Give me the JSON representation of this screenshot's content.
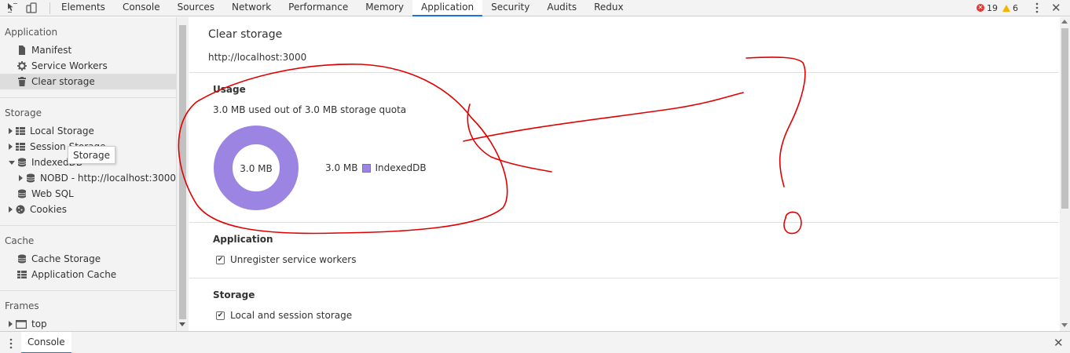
{
  "toolbar": {
    "tabs": [
      "Elements",
      "Console",
      "Sources",
      "Network",
      "Performance",
      "Memory",
      "Application",
      "Security",
      "Audits",
      "Redux"
    ],
    "active_tab": "Application",
    "error_count": "19",
    "warning_count": "6"
  },
  "sidebar": {
    "application_title": "Application",
    "application_items": [
      "Manifest",
      "Service Workers",
      "Clear storage"
    ],
    "storage_title": "Storage",
    "storage_items": [
      "Local Storage",
      "Session Storage",
      "IndexedDB",
      "NOBD - http://localhost:3000",
      "Web SQL",
      "Cookies"
    ],
    "cache_title": "Cache",
    "cache_items": [
      "Cache Storage",
      "Application Cache"
    ],
    "frames_title": "Frames",
    "frames_items": [
      "top"
    ],
    "tooltip": "Storage"
  },
  "main": {
    "title": "Clear storage",
    "origin": "http://localhost:3000",
    "usage_heading": "Usage",
    "usage_text": "3.0 MB used out of 3.0 MB storage quota",
    "donut_center": "3.0 MB",
    "legend_value": "3.0 MB",
    "legend_label": "IndexedDB",
    "application_heading": "Application",
    "application_checkbox": "Unregister service workers",
    "storage_heading": "Storage",
    "storage_checkbox": "Local and session storage"
  },
  "drawer": {
    "tab": "Console"
  },
  "colors": {
    "accent": "#1a73e8",
    "indexeddb": "#9c84e3",
    "annotation": "#e00000"
  }
}
